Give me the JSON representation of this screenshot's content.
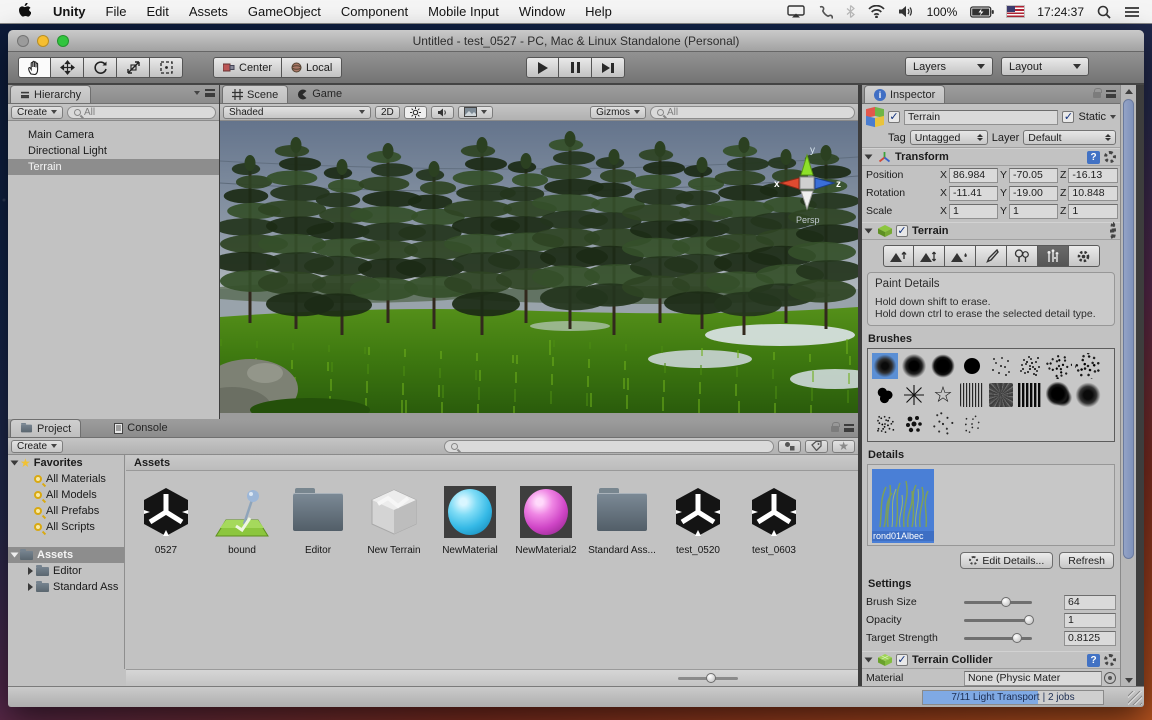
{
  "menu_bar": {
    "items": [
      "Unity",
      "File",
      "Edit",
      "Assets",
      "GameObject",
      "Component",
      "Mobile Input",
      "Window",
      "Help"
    ],
    "battery_pct": "100%",
    "time": "17:24:37"
  },
  "window": {
    "title": "Untitled - test_0527 - PC, Mac & Linux Standalone (Personal)"
  },
  "toolbar": {
    "center": "Center",
    "local": "Local",
    "layers": "Layers",
    "layout": "Layout"
  },
  "hierarchy": {
    "tab": "Hierarchy",
    "create": "Create",
    "search": "All",
    "items": [
      {
        "label": "Main Camera"
      },
      {
        "label": "Directional Light"
      },
      {
        "label": "Terrain"
      }
    ]
  },
  "scene": {
    "tab_scene": "Scene",
    "tab_game": "Game",
    "shading": "Shaded",
    "btn_2d": "2D",
    "gizmos": "Gizmos",
    "search": "All",
    "axis": {
      "x": "x",
      "y": "y",
      "z": "z"
    },
    "persp": "Persp"
  },
  "project": {
    "tab_project": "Project",
    "tab_console": "Console",
    "create": "Create",
    "favorites": {
      "label": "Favorites",
      "items": [
        "All Materials",
        "All Models",
        "All Prefabs",
        "All Scripts"
      ]
    },
    "tree": {
      "root": "Assets",
      "children": [
        "Editor",
        "Standard Ass"
      ]
    },
    "header": "Assets",
    "assets": [
      {
        "name": "0527",
        "type": "unity-scene"
      },
      {
        "name": "bound",
        "type": "prefab"
      },
      {
        "name": "Editor",
        "type": "folder"
      },
      {
        "name": "New Terrain",
        "type": "terrain-asset"
      },
      {
        "name": "NewMaterial",
        "type": "material-cyan"
      },
      {
        "name": "NewMaterial2",
        "type": "material-magenta"
      },
      {
        "name": "Standard Ass...",
        "type": "folder"
      },
      {
        "name": "test_0520",
        "type": "unity-scene"
      },
      {
        "name": "test_0603",
        "type": "unity-scene"
      }
    ]
  },
  "inspector": {
    "tab": "Inspector",
    "name": "Terrain",
    "static": "Static",
    "tag_label": "Tag",
    "tag": "Untagged",
    "layer_label": "Layer",
    "layer": "Default",
    "axes": [
      "X",
      "Y",
      "Z"
    ],
    "transform": {
      "title": "Transform",
      "rows": [
        {
          "label": "Position",
          "x": "86.984",
          "y": "-70.05",
          "z": "-16.13"
        },
        {
          "label": "Rotation",
          "x": "-11.41",
          "y": "-19.00",
          "z": "10.848"
        },
        {
          "label": "Scale",
          "x": "1",
          "y": "1",
          "z": "1"
        }
      ]
    },
    "terrain": {
      "title": "Terrain",
      "tools": [
        "raise-lower-terrain",
        "paint-height",
        "smooth-height",
        "paint-texture",
        "place-trees",
        "paint-details",
        "terrain-settings"
      ],
      "selected_tool": "paint-details",
      "info_title": "Paint Details",
      "info_line1": "Hold down shift to erase.",
      "info_line2": "Hold down ctrl to erase the selected detail type.",
      "brushes_label": "Brushes",
      "brushes": [
        "soft-circle-small",
        "soft-circle",
        "soft-circle-large",
        "solid-circle",
        "speckle-light",
        "speckle-dense",
        "speckle-coarse",
        "speckle-blob",
        "cluster-rings",
        "spike-star",
        "star-outline",
        "vertical-streaks",
        "noise-patch",
        "dense-streaks",
        "ink-blob",
        "soft-blob",
        "scatter-burst",
        "dot-cluster",
        "scatter-fine",
        "scatter-sparse"
      ],
      "selected_brush": "soft-circle-small",
      "details_label": "Details",
      "detail_name": "rond01Albec",
      "edit_details": "Edit Details...",
      "refresh": "Refresh",
      "settings_label": "Settings",
      "settings": [
        {
          "label": "Brush Size",
          "value": "64",
          "pct": 62
        },
        {
          "label": "Opacity",
          "value": "1",
          "pct": 95
        },
        {
          "label": "Target Strength",
          "value": "0.8125",
          "pct": 78
        }
      ]
    },
    "collider": {
      "title": "Terrain Collider",
      "material_label": "Material",
      "material_value": "None (Physic Mater"
    }
  },
  "status_bar": {
    "progress": "7/11 Light Transport",
    "jobs": "| 2 jobs",
    "progress_pct": 64
  },
  "colors": {
    "accent_selection": "#5b8fd4",
    "progress_fill": "#7fa9e4",
    "sky_top": "#64748c",
    "grass": "#3f7a10"
  }
}
